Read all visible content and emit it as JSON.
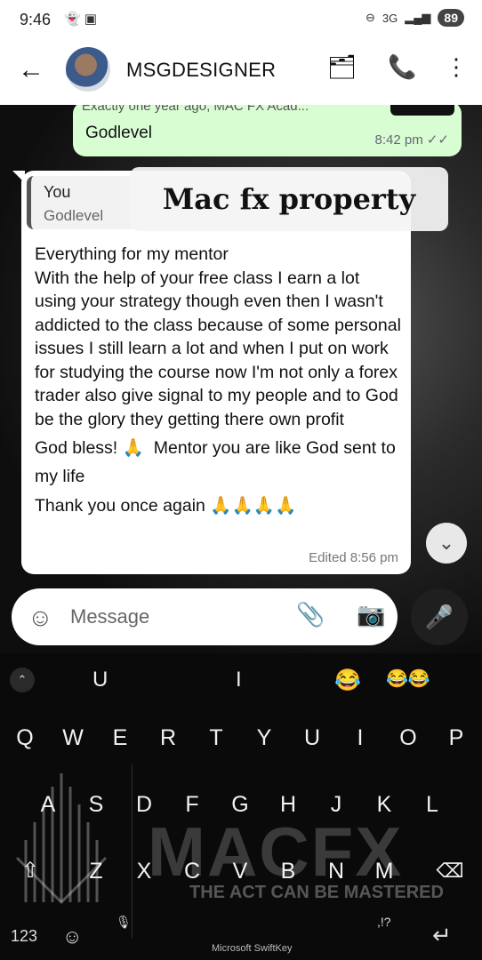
{
  "status": {
    "time": "9:46",
    "network": "3G",
    "battery": "89"
  },
  "header": {
    "contact_name": "MSGDESIGNER"
  },
  "outgoing": {
    "quoted_text": "Exactly one year ago, MAC FX Acad...",
    "text": "Godlevel",
    "time": "8:42 pm",
    "ticks": "✓✓"
  },
  "incoming": {
    "reply_author": "You",
    "reply_text": "Godlevel",
    "overlay": "Mac fx property",
    "lines": [
      "Everything for my mentor\nWith the help of your free class I earn a lot using your strategy though even then I wasn't addicted to the class because of some personal issues I still learn a lot and when I put on work for studying the course now I'm not only a forex trader also give signal to my people and to God be the glory they getting there own profit",
      "God bless! 🙏  Mentor you are like God sent to my life",
      "Thank you once again 🙏🙏🙏🙏"
    ],
    "meta": "Edited 8:56 pm"
  },
  "composer": {
    "placeholder": "Message"
  },
  "keyboard": {
    "suggestions": [
      "U",
      "I",
      "😂",
      "😂😂"
    ],
    "row1": [
      "Q",
      "W",
      "E",
      "R",
      "T",
      "Y",
      "U",
      "I",
      "O",
      "P"
    ],
    "row2": [
      "A",
      "S",
      "D",
      "F",
      "G",
      "H",
      "J",
      "K",
      "L"
    ],
    "row3": [
      "Z",
      "X",
      "C",
      "V",
      "B",
      "N",
      "M"
    ],
    "numbers_key": "123",
    "punct_hint": ",!?",
    "brand": "Microsoft SwiftKey",
    "watermark": "MACFX",
    "watermark_sub": "THE ACT CAN BE MASTERED"
  }
}
